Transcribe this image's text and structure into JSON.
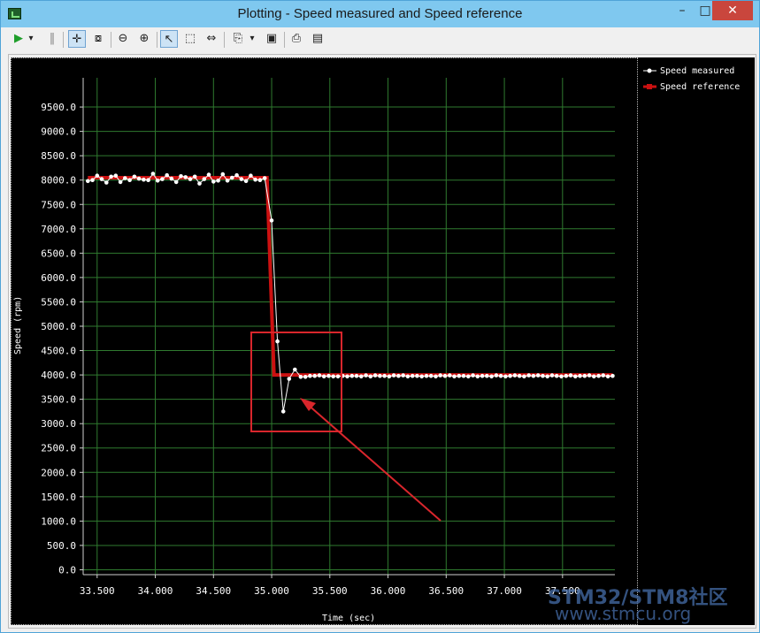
{
  "window": {
    "title": "Plotting  - Speed measured and Speed reference",
    "min_glyph": "–",
    "max_glyph": "□",
    "close_glyph": "✕"
  },
  "toolbar": {
    "run_glyph": "▶",
    "dropdown_glyph": "▾",
    "pause_glyph": "‖",
    "pan_glyph": "✛",
    "zoomfit_glyph": "⧇",
    "zoomout_glyph": "⊖",
    "zoomin_glyph": "⊕",
    "select_glyph": "↖",
    "rect_glyph": "⬚",
    "split_glyph": "⇔",
    "copy_glyph": "⎘",
    "save_glyph": "▣",
    "print_glyph": "⎙",
    "preview_glyph": "▤"
  },
  "colors": {
    "plot_bg": "#000000",
    "grid": "#2f7a2f",
    "axis_text": "#ffffff",
    "measured": "#ffffff",
    "reference": "#cc1111",
    "annotation": "#d9262c"
  },
  "chart_data": {
    "type": "line",
    "xlabel": "Time (sec)",
    "ylabel": "Speed (rpm)",
    "xlim": [
      33.38,
      37.95
    ],
    "ylim": [
      -100,
      10100
    ],
    "xticks": [
      33.5,
      34.0,
      34.5,
      35.0,
      35.5,
      36.0,
      36.5,
      37.0,
      37.5
    ],
    "xtick_labels": [
      "33.500",
      "34.000",
      "34.500",
      "35.000",
      "35.500",
      "36.000",
      "36.500",
      "37.000",
      "37.500"
    ],
    "yticks": [
      0,
      500,
      1000,
      1500,
      2000,
      2500,
      3000,
      3500,
      4000,
      4500,
      5000,
      5500,
      6000,
      6500,
      7000,
      7500,
      8000,
      8500,
      9000,
      9500
    ],
    "ytick_labels": [
      "0.0",
      "500.0",
      "1000.0",
      "1500.0",
      "2000.0",
      "2500.0",
      "3000.0",
      "3500.0",
      "4000.0",
      "4500.0",
      "5000.0",
      "5500.0",
      "6000.0",
      "6500.0",
      "7000.0",
      "7500.0",
      "8000.0",
      "8500.0",
      "9000.0",
      "9500.0"
    ],
    "grid": true,
    "legend_position": "right",
    "series": [
      {
        "name": "Speed measured",
        "color": "#ffffff",
        "marker": "circle",
        "x": [
          33.42,
          33.46,
          33.5,
          33.54,
          33.58,
          33.62,
          33.66,
          33.7,
          33.74,
          33.78,
          33.82,
          33.86,
          33.9,
          33.94,
          33.98,
          34.02,
          34.06,
          34.1,
          34.14,
          34.18,
          34.22,
          34.26,
          34.3,
          34.34,
          34.38,
          34.42,
          34.46,
          34.5,
          34.54,
          34.58,
          34.62,
          34.66,
          34.7,
          34.74,
          34.78,
          34.82,
          34.86,
          34.9,
          34.94,
          35.0,
          35.05,
          35.1,
          35.15,
          35.2,
          35.25,
          35.29,
          35.33,
          35.37,
          35.41,
          35.45,
          35.49,
          35.53,
          35.57,
          35.61,
          35.65,
          35.69,
          35.73,
          35.77,
          35.81,
          35.85,
          35.89,
          35.93,
          35.97,
          36.01,
          36.05,
          36.09,
          36.13,
          36.17,
          36.21,
          36.25,
          36.29,
          36.33,
          36.37,
          36.41,
          36.45,
          36.49,
          36.53,
          36.57,
          36.61,
          36.65,
          36.69,
          36.73,
          36.77,
          36.81,
          36.85,
          36.89,
          36.93,
          36.97,
          37.01,
          37.05,
          37.09,
          37.13,
          37.17,
          37.21,
          37.25,
          37.29,
          37.33,
          37.37,
          37.41,
          37.45,
          37.49,
          37.53,
          37.57,
          37.61,
          37.65,
          37.69,
          37.73,
          37.77,
          37.81,
          37.85,
          37.89,
          37.93
        ],
        "y": [
          7980,
          8000,
          8090,
          8020,
          7950,
          8070,
          8090,
          7960,
          8040,
          8000,
          8070,
          8030,
          8010,
          8000,
          8130,
          7990,
          8020,
          8100,
          8030,
          7960,
          8080,
          8060,
          8020,
          8070,
          7930,
          8020,
          8110,
          7970,
          7990,
          8120,
          7990,
          8050,
          8100,
          8020,
          7980,
          8090,
          8010,
          8000,
          8040,
          7170,
          4690,
          3250,
          3920,
          4110,
          3960,
          3960,
          3980,
          3980,
          3990,
          3970,
          3980,
          3970,
          3970,
          3980,
          3970,
          3980,
          3980,
          3970,
          3990,
          3970,
          3990,
          3980,
          3980,
          3970,
          3990,
          3980,
          3990,
          3970,
          3980,
          3980,
          3970,
          3980,
          3980,
          3970,
          3990,
          3980,
          3990,
          3970,
          3980,
          3980,
          3970,
          3990,
          3970,
          3980,
          3980,
          3970,
          3990,
          3980,
          3970,
          3980,
          3990,
          3980,
          3970,
          3990,
          3980,
          3990,
          3980,
          3970,
          3990,
          3980,
          3970,
          3980,
          3990,
          3970,
          3980,
          3980,
          3990,
          3970,
          3980,
          3990,
          3970,
          3980
        ]
      },
      {
        "name": "Speed reference",
        "color": "#cc1111",
        "marker": "square",
        "x": [
          33.42,
          34.96,
          35.02,
          37.93
        ],
        "y": [
          8050,
          8050,
          4000,
          4000
        ]
      }
    ]
  },
  "watermark": {
    "line1": "STM32/STM8社区",
    "line2": "www.stmcu.org"
  }
}
